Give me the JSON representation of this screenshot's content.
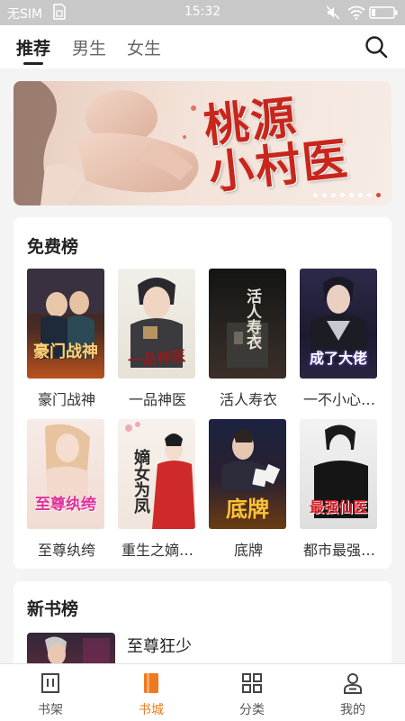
{
  "status_bar": {
    "carrier": "无SIM",
    "time": "15:32"
  },
  "top_nav": {
    "tabs": [
      {
        "label": "推荐",
        "active": true
      },
      {
        "label": "男生"
      },
      {
        "label": "女生"
      }
    ]
  },
  "banner": {
    "title_line1": "桃源",
    "title_line2": "小村医",
    "dot_count": 8,
    "active_dot": 7
  },
  "free_ranking": {
    "title": "免费榜",
    "books": [
      {
        "title": "豪门战神",
        "cover_text": "豪门战神"
      },
      {
        "title": "一品神医",
        "cover_text": "一品神医"
      },
      {
        "title": "活人寿衣",
        "cover_text": "活人寿衣"
      },
      {
        "title": "一不小心…",
        "cover_text": "成了大佬"
      },
      {
        "title": "至尊纨绔",
        "cover_text": "至尊纨绔"
      },
      {
        "title": "重生之嫡…",
        "cover_text": "嫡女为凤"
      },
      {
        "title": "底牌",
        "cover_text": "底牌"
      },
      {
        "title": "都市最强…",
        "cover_text": "最强仙医"
      }
    ]
  },
  "new_ranking": {
    "title": "新书榜",
    "first_book": {
      "title": "至尊狂少"
    }
  },
  "bottom_nav": {
    "items": [
      {
        "label": "书架"
      },
      {
        "label": "书城",
        "active": true
      },
      {
        "label": "分类"
      },
      {
        "label": "我的"
      }
    ]
  },
  "colors": {
    "accent": "#ef7a1d",
    "banner_title": "#c8261c"
  }
}
